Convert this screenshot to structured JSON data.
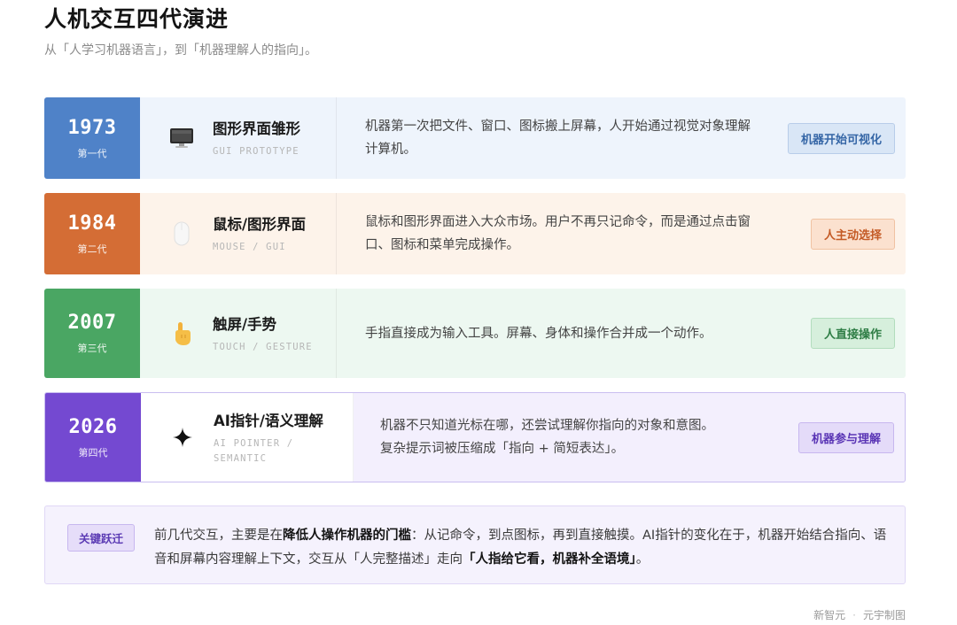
{
  "title": "人机交互四代演进",
  "subtitle": "从「人学习机器语言」，到「机器理解人的指向」。",
  "generations": [
    {
      "year": "1973",
      "gen_label": "第一代",
      "name_cn": "图形界面雏形",
      "name_en": "GUI PROTOTYPE",
      "icon": "monitor-icon",
      "desc": "机器第一次把文件、窗口、图标搬上屏幕，人开始通过视觉对象理解计算机。",
      "tag": "机器开始可视化",
      "accent": "#4f82c8"
    },
    {
      "year": "1984",
      "gen_label": "第二代",
      "name_cn": "鼠标/图形界面",
      "name_en": "MOUSE / GUI",
      "icon": "mouse-icon",
      "desc": "鼠标和图形界面进入大众市场。用户不再只记命令，而是通过点击窗口、图标和菜单完成操作。",
      "tag": "人主动选择",
      "accent": "#d46d35"
    },
    {
      "year": "2007",
      "gen_label": "第三代",
      "name_cn": "触屏/手势",
      "name_en": "TOUCH / GESTURE",
      "icon": "pointing-hand-icon",
      "desc": "手指直接成为输入工具。屏幕、身体和操作合并成一个动作。",
      "tag": "人直接操作",
      "accent": "#4aa663"
    },
    {
      "year": "2026",
      "gen_label": "第四代",
      "name_cn": "AI指针/语义理解",
      "name_en": "AI POINTER / SEMANTIC",
      "icon": "sparkle-icon",
      "desc_line1": "机器不只知道光标在哪，还尝试理解你指向的对象和意图。",
      "desc_line2": "复杂提示词被压缩成「指向 + 简短表达」。",
      "tag": "机器参与理解",
      "accent": "#7449d1"
    }
  ],
  "note": {
    "badge": "关键跃迁",
    "part1": "前几代交互，主要是在",
    "bold1": "降低人操作机器的门槛",
    "part2": "：从记命令，到点图标，再到直接触摸。AI指针的变化在于，机器开始结合指向、语音和屏幕内容理解上下文，交互从「人完整描述」走向",
    "bold2": "「人指给它看，机器补全语境」",
    "part3": "。"
  },
  "credit": {
    "left": "新智元",
    "sep": "·",
    "right": "元宇制图"
  }
}
